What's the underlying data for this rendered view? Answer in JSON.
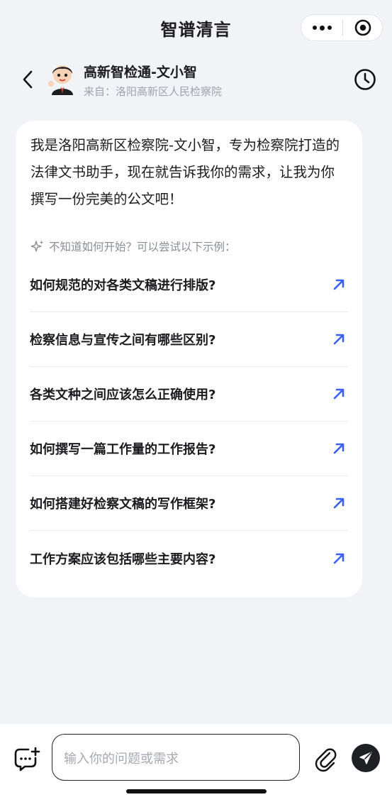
{
  "app": {
    "title": "智谱清言"
  },
  "header": {
    "bot_name": "高新智检通-文小智",
    "source": "来自：洛阳高新区人民检察院"
  },
  "intro": "我是洛阳高新区检察院-文小智，专为检察院打造的法律文书助手，现在就告诉我你的需求，让我为你撰写一份完美的公文吧！",
  "hint": "不知道如何开始？可以尝试以下示例：",
  "suggestions": [
    {
      "label": "如何规范的对各类文稿进行排版?"
    },
    {
      "label": "检察信息与宣传之间有哪些区别?"
    },
    {
      "label": "各类文种之间应该怎么正确使用?"
    },
    {
      "label": "如何撰写一篇工作量的工作报告?"
    },
    {
      "label": "如何搭建好检察文稿的写作框架?"
    },
    {
      "label": "工作方案应该包括哪些主要内容?"
    }
  ],
  "input": {
    "placeholder": "输入你的问题或需求"
  },
  "colors": {
    "accent": "#3a5ff5",
    "background": "#f2f3f7",
    "send_button": "#1f2024"
  },
  "icons": {
    "back": "chevron-left-icon",
    "history": "clock-icon",
    "more": "more-dots-icon",
    "target": "target-icon",
    "sparkle": "sparkle-icon",
    "arrow": "arrow-up-right-icon",
    "add": "chat-add-icon",
    "clip": "paperclip-icon",
    "send": "send-icon"
  }
}
